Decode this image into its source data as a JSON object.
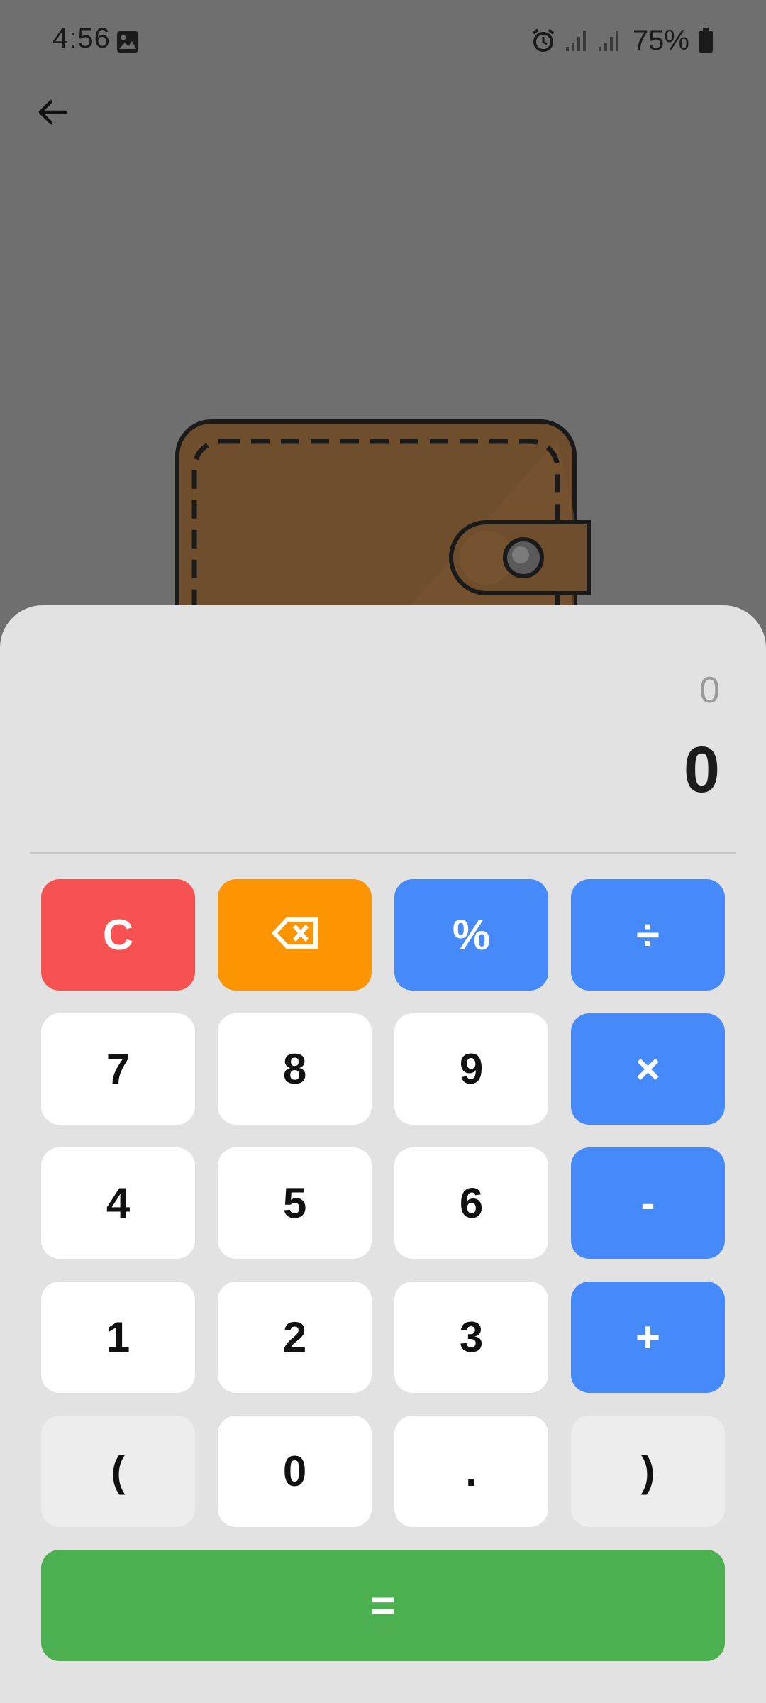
{
  "status_bar": {
    "time": "4:56",
    "battery_percent": "75%",
    "icons": [
      "gallery-icon",
      "alarm-icon",
      "signal-icon",
      "signal-icon",
      "battery-icon"
    ]
  },
  "nav": {
    "back_icon": "arrow-left-icon"
  },
  "display": {
    "expression": "0",
    "result": "0"
  },
  "keys": {
    "clear": "C",
    "backspace_icon": "backspace-icon",
    "percent": "%",
    "divide": "÷",
    "seven": "7",
    "eight": "8",
    "nine": "9",
    "multiply": "×",
    "four": "4",
    "five": "5",
    "six": "6",
    "minus": "-",
    "one": "1",
    "two": "2",
    "three": "3",
    "plus": "+",
    "open_paren": "(",
    "zero": "0",
    "dot": ".",
    "close_paren": ")",
    "equals": "="
  },
  "colors": {
    "clear": "#f75252",
    "backspace": "#fd9402",
    "operator": "#4589fb",
    "equals": "#4caf50",
    "digit": "#ffffff",
    "paren": "#ededed",
    "overlay": "#6f6f6f",
    "sheet": "#e2e2e2",
    "wallet": "#6e4e2d"
  }
}
